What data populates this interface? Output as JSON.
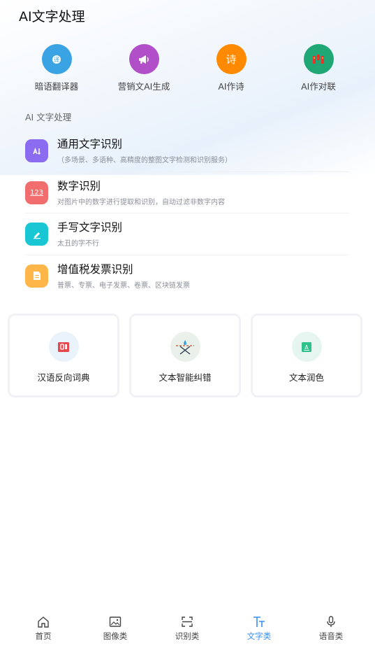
{
  "header": {
    "title": "AI文字处理"
  },
  "quick_actions": [
    {
      "label": "暗语翻译器",
      "icon": "translate-icon",
      "color": "#3aa3e3"
    },
    {
      "label": "营销文AI生成",
      "icon": "megaphone-icon",
      "color": "#b04fc8"
    },
    {
      "label": "AI作诗",
      "icon": "poem-icon",
      "icon_text": "诗",
      "color": "#ff8a00"
    },
    {
      "label": "AI作对联",
      "icon": "couplet-icon",
      "color": "#1fa776"
    }
  ],
  "section": {
    "title": "AI 文字处理"
  },
  "list": [
    {
      "title": "通用文字识别",
      "subtitle": "（多场景、多语种、高精度的整图文字检测和识别服务）",
      "icon": "text-recognize-icon",
      "color": "#8b6cf0"
    },
    {
      "title": "数字识别",
      "subtitle": "对图片中的数字进行提取和识别，自动过滤非数字内容",
      "icon": "number-icon",
      "icon_text": "123",
      "color": "#f26d6d"
    },
    {
      "title": "手写文字识别",
      "subtitle": "太丑的字不行",
      "icon": "pen-icon",
      "color": "#19c6d3"
    },
    {
      "title": "增值税发票识别",
      "subtitle": "普票、专票、电子发票、卷票、区块链发票",
      "icon": "invoice-icon",
      "color": "#ffb648"
    }
  ],
  "cards": [
    {
      "label": "汉语反向词典",
      "icon": "dictionary-icon",
      "bg": "#eaf2fb"
    },
    {
      "label": "文本智能纠错",
      "icon": "correction-icon",
      "bg": "#eaf1ea"
    },
    {
      "label": "文本润色",
      "icon": "polish-icon",
      "bg": "#e6f5ef"
    }
  ],
  "tabbar": {
    "active_color": "#3a8ef6",
    "items": [
      {
        "label": "首页",
        "icon": "home-icon"
      },
      {
        "label": "图像类",
        "icon": "image-icon"
      },
      {
        "label": "识别类",
        "icon": "scan-icon"
      },
      {
        "label": "文字类",
        "icon": "text-type-icon"
      },
      {
        "label": "语音类",
        "icon": "microphone-icon"
      }
    ]
  }
}
